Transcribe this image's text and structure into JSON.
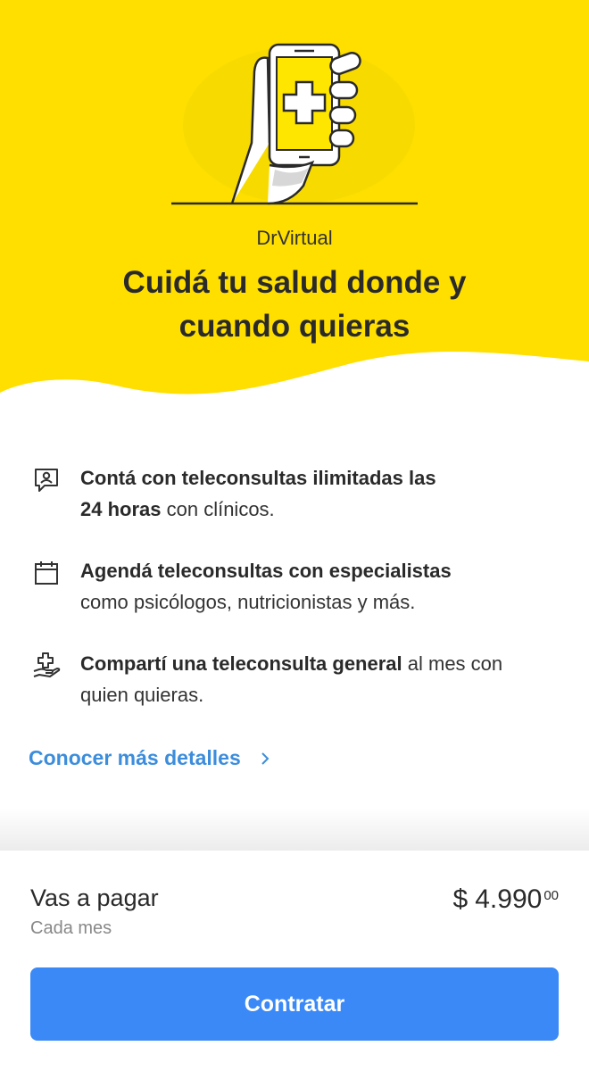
{
  "colors": {
    "hero_yellow": "#ffe600",
    "link_blue": "#3c8ddb",
    "cta_blue": "#3a89f7"
  },
  "hero": {
    "illustration": "hand-holding-phone-medical-cross-illustration",
    "brand": "DrVirtual",
    "headline_line1": "Cuidá tu salud donde y",
    "headline_line2": "cuando quieras"
  },
  "features": [
    {
      "icon": "consultation-chat-icon",
      "bold": "Contá con teleconsultas ilimitadas las",
      "bold2": "24 horas",
      "normal": " con clínicos."
    },
    {
      "icon": "calendar-icon",
      "bold": "Agendá teleconsultas con especialistas",
      "normal": "como psicólogos, nutricionistas y más."
    },
    {
      "icon": "hand-medical-cross-icon",
      "bold": "Compartí una teleconsulta general",
      "normal": " al mes con quien quieras."
    }
  ],
  "more_link": {
    "label": "Conocer más detalles",
    "icon": "chevron-right-icon"
  },
  "footer": {
    "pay_label": "Vas a pagar",
    "pay_sub": "Cada mes",
    "currency": "$",
    "amount": "4.990",
    "cents": "00",
    "cta_label": "Contratar"
  }
}
